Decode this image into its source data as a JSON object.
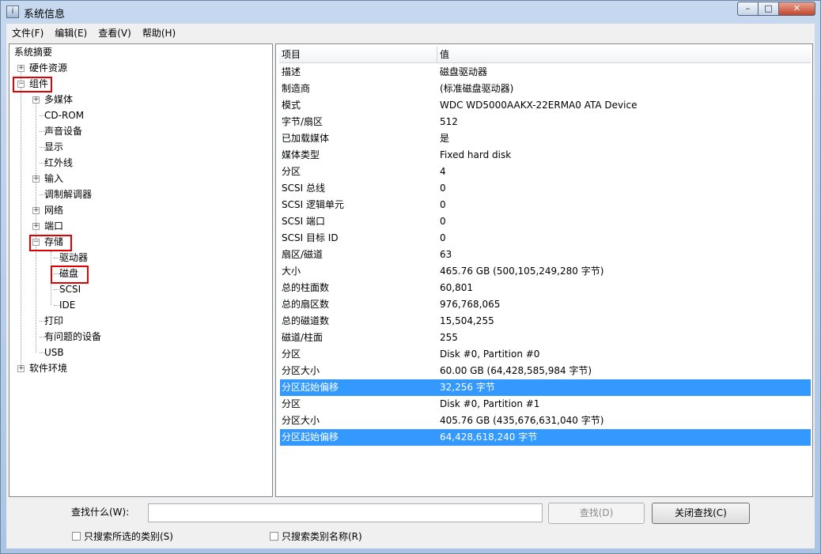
{
  "window": {
    "title": "系统信息",
    "icon": "system-info-icon"
  },
  "menu": [
    "文件(F)",
    "编辑(E)",
    "查看(V)",
    "帮助(H)"
  ],
  "tree": {
    "root": "系统摘要",
    "hardware": "硬件资源",
    "components": "组件",
    "multimedia": "多媒体",
    "cdrom": "CD-ROM",
    "sound": "声音设备",
    "display": "显示",
    "infrared": "红外线",
    "input": "输入",
    "modem": "调制解调器",
    "network": "网络",
    "ports": "端口",
    "storage": "存储",
    "drives": "驱动器",
    "disks": "磁盘",
    "scsi": "SCSI",
    "ide": "IDE",
    "printing": "打印",
    "problem": "有问题的设备",
    "usb": "USB",
    "software": "软件环境"
  },
  "list": {
    "col_item": "项目",
    "col_value": "值",
    "rows": [
      {
        "item": "描述",
        "value": "磁盘驱动器"
      },
      {
        "item": "制造商",
        "value": "(标准磁盘驱动器)"
      },
      {
        "item": "模式",
        "value": "WDC WD5000AAKX-22ERMA0 ATA Device"
      },
      {
        "item": "字节/扇区",
        "value": "512"
      },
      {
        "item": "已加载媒体",
        "value": "是"
      },
      {
        "item": "媒体类型",
        "value": "Fixed hard disk"
      },
      {
        "item": "分区",
        "value": "4"
      },
      {
        "item": "SCSI 总线",
        "value": "0"
      },
      {
        "item": "SCSI 逻辑单元",
        "value": "0"
      },
      {
        "item": "SCSI 端口",
        "value": "0"
      },
      {
        "item": "SCSI 目标 ID",
        "value": "0"
      },
      {
        "item": "扇区/磁道",
        "value": "63"
      },
      {
        "item": "大小",
        "value": "465.76 GB (500,105,249,280 字节)"
      },
      {
        "item": "总的柱面数",
        "value": "60,801"
      },
      {
        "item": "总的扇区数",
        "value": "976,768,065"
      },
      {
        "item": "总的磁道数",
        "value": "15,504,255"
      },
      {
        "item": "磁道/柱面",
        "value": "255"
      },
      {
        "item": "分区",
        "value": "Disk #0, Partition #0"
      },
      {
        "item": "分区大小",
        "value": "60.00 GB (64,428,585,984 字节)"
      },
      {
        "item": "分区起始偏移",
        "value": "32,256 字节",
        "selected": true
      },
      {
        "item": "分区",
        "value": "Disk #0, Partition #1"
      },
      {
        "item": "分区大小",
        "value": "405.76 GB (435,676,631,040 字节)"
      },
      {
        "item": "分区起始偏移",
        "value": "64,428,618,240 字节",
        "selected": true
      }
    ]
  },
  "find": {
    "label": "查找什么(W):",
    "value": "",
    "find_button": "查找(D)",
    "close_button": "关闭查找(C)",
    "chk_selected": "只搜索所选的类别(S)",
    "chk_names": "只搜索类别名称(R)"
  },
  "colors": {
    "selection": "#3399ff",
    "highlight_box": "#e00000"
  }
}
